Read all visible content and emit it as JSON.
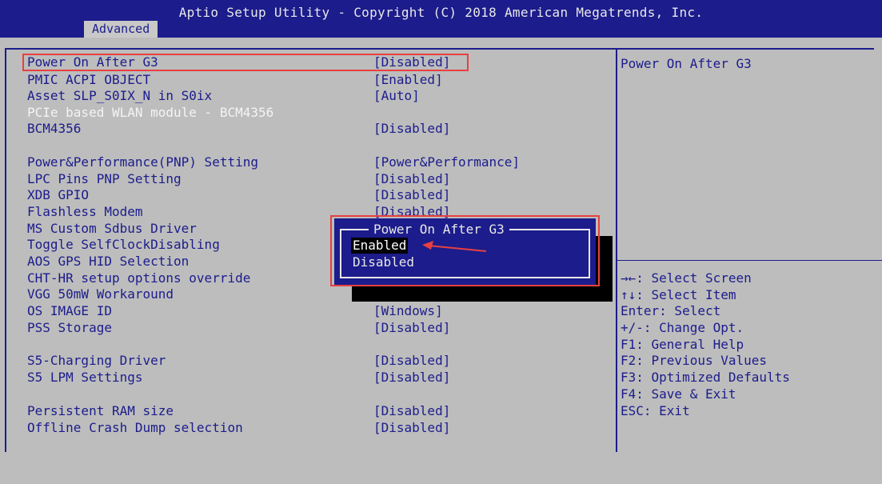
{
  "header": {
    "title": "Aptio Setup Utility - Copyright (C) 2018 American Megatrends, Inc.",
    "active_tab": "Advanced"
  },
  "settings": [
    {
      "label": "Power On After G3",
      "value": "[Disabled]"
    },
    {
      "label": "PMIC ACPI OBJECT",
      "value": "[Enabled]"
    },
    {
      "label": "Asset SLP_S0IX_N in S0ix",
      "value": "[Auto]"
    },
    {
      "label": "PCIe based WLAN module - BCM4356",
      "value": ""
    },
    {
      "label": "BCM4356",
      "value": "[Disabled]"
    },
    {
      "label": "Power&Performance(PNP) Setting",
      "value": "[Power&Performance]"
    },
    {
      "label": "LPC Pins PNP Setting",
      "value": "[Disabled]"
    },
    {
      "label": "XDB GPIO",
      "value": "[Disabled]"
    },
    {
      "label": "Flashless Modem",
      "value": "[Disabled]"
    },
    {
      "label": "MS Custom Sdbus Driver",
      "value": ""
    },
    {
      "label": "Toggle SelfClockDisabling",
      "value": ""
    },
    {
      "label": "AOS GPS HID Selection",
      "value": ""
    },
    {
      "label": "CHT-HR setup options override",
      "value": ""
    },
    {
      "label": "VGG 50mW Workaround",
      "value": ""
    },
    {
      "label": "OS IMAGE ID",
      "value": "[Windows]"
    },
    {
      "label": "PSS Storage",
      "value": "[Disabled]"
    },
    {
      "label": "S5-Charging Driver",
      "value": "[Disabled]"
    },
    {
      "label": "S5 LPM Settings",
      "value": "[Disabled]"
    },
    {
      "label": "Persistent RAM size",
      "value": "[Disabled]"
    },
    {
      "label": "Offline Crash Dump selection",
      "value": "[Disabled]"
    }
  ],
  "help": {
    "title": "Power On After G3",
    "keys": [
      "→←: Select Screen",
      "↑↓: Select Item",
      "Enter: Select",
      "+/-: Change Opt.",
      "F1: General Help",
      "F2: Previous Values",
      "F3: Optimized Defaults",
      "F4: Save & Exit",
      "ESC: Exit"
    ]
  },
  "popup": {
    "title": "Power On After G3",
    "options": [
      "Enabled",
      "Disabled"
    ]
  },
  "colors": {
    "bios_blue": "#1c1c8c",
    "background_gray": "#bdbdbd",
    "annotation_red": "#e84040"
  }
}
